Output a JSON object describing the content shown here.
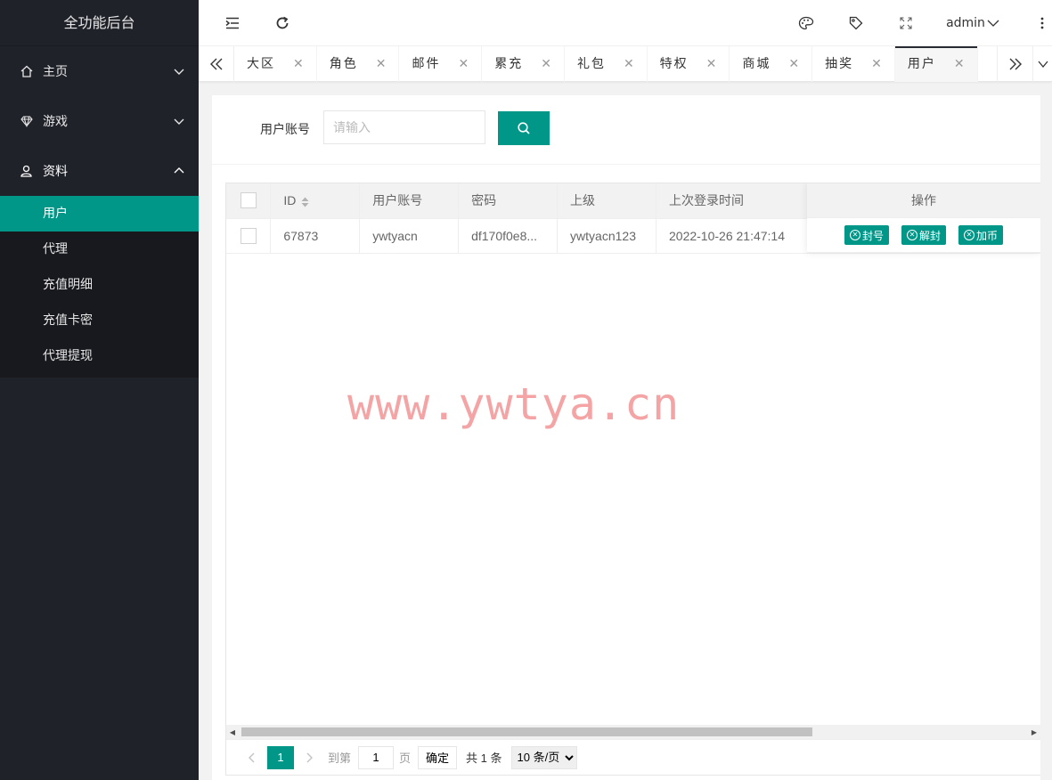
{
  "app": {
    "title": "全功能后台"
  },
  "sidebar": {
    "menus": [
      {
        "label": "主页",
        "icon": "home-icon",
        "expanded": false
      },
      {
        "label": "游戏",
        "icon": "diamond-icon",
        "expanded": false
      },
      {
        "label": "资料",
        "icon": "user-icon",
        "expanded": true
      }
    ],
    "submenu": [
      {
        "label": "用户",
        "active": true
      },
      {
        "label": "代理",
        "active": false
      },
      {
        "label": "充值明细",
        "active": false
      },
      {
        "label": "充值卡密",
        "active": false
      },
      {
        "label": "代理提现",
        "active": false
      }
    ]
  },
  "header": {
    "user": "admin",
    "icons": [
      "menu-fold-icon",
      "refresh-icon",
      "palette-icon",
      "tag-icon",
      "fullscreen-icon",
      "more-icon"
    ]
  },
  "tabs": [
    {
      "label": "大区",
      "active": false
    },
    {
      "label": "角色",
      "active": false
    },
    {
      "label": "邮件",
      "active": false
    },
    {
      "label": "累充",
      "active": false
    },
    {
      "label": "礼包",
      "active": false
    },
    {
      "label": "特权",
      "active": false
    },
    {
      "label": "商城",
      "active": false
    },
    {
      "label": "抽奖",
      "active": false
    },
    {
      "label": "用户",
      "active": true
    }
  ],
  "search": {
    "label": "用户账号",
    "placeholder": "请输入",
    "value": ""
  },
  "table": {
    "columns": {
      "id": "ID",
      "account": "用户账号",
      "password": "密码",
      "parent": "上级",
      "last_login": "上次登录时间",
      "ops": "操作"
    },
    "rows": [
      {
        "id": "67873",
        "account": "ywtyacn",
        "password": "df170f0e8...",
        "parent": "ywtyacn123",
        "last_login": "2022-10-26 21:47:14"
      }
    ],
    "actions": [
      "封号",
      "解封",
      "加币"
    ]
  },
  "pager": {
    "current": "1",
    "goto_label": "到第",
    "goto_value": "1",
    "page_unit": "页",
    "confirm": "确定",
    "total": "共 1 条",
    "page_size": "10 条/页"
  },
  "watermark": "www.ywtya.cn",
  "colors": {
    "accent": "#009688",
    "sidebar_bg": "#20222a",
    "watermark": "#eb5a5a"
  }
}
